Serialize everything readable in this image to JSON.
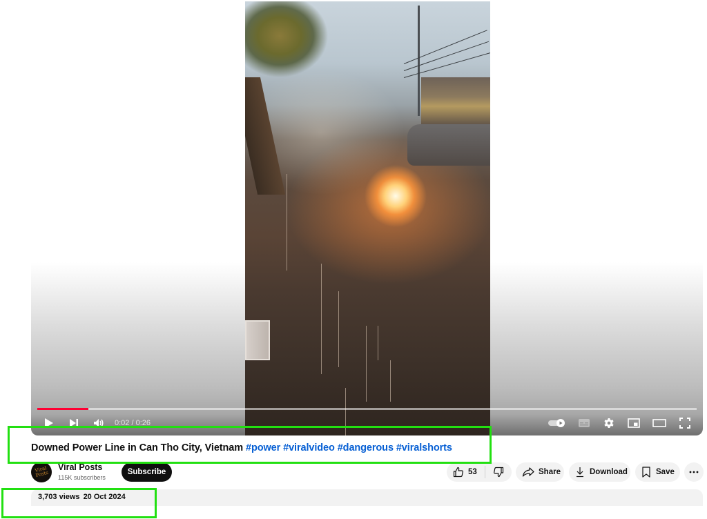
{
  "player": {
    "progress_fraction": 0.077,
    "current_time": "0:02",
    "duration": "0:26",
    "time_display": "0:02 / 0:26",
    "accent_color": "#ff0033",
    "controls_left": [
      {
        "name": "play",
        "icon": "play-icon"
      },
      {
        "name": "next",
        "icon": "next-icon"
      },
      {
        "name": "volume",
        "icon": "volume-icon"
      }
    ],
    "controls_right": [
      {
        "name": "autoplay",
        "icon": "autoplay-toggle-icon"
      },
      {
        "name": "subtitles",
        "icon": "subtitles-icon"
      },
      {
        "name": "settings",
        "icon": "gear-icon"
      },
      {
        "name": "miniplayer",
        "icon": "miniplayer-icon"
      },
      {
        "name": "theater",
        "icon": "theater-mode-icon"
      },
      {
        "name": "fullscreen",
        "icon": "fullscreen-icon"
      }
    ]
  },
  "video": {
    "title_text": "Downed Power Line in Can Tho City, Vietnam",
    "hashtags": [
      "#power",
      "#viralvideo",
      "#dangerous",
      "#viralshorts"
    ],
    "hashtag_color": "#065fd4"
  },
  "channel": {
    "name": "Viral Posts",
    "subscribers": "115K subscribers",
    "avatar_text": "Viral Posts",
    "subscribe_label": "Subscribe"
  },
  "actions": {
    "like_count": "53",
    "share_label": "Share",
    "download_label": "Download",
    "save_label": "Save",
    "more_label": "More actions"
  },
  "description": {
    "views": "3,703 views",
    "date": "20 Oct 2024"
  },
  "annotations": {
    "highlight_color": "#22e011"
  }
}
